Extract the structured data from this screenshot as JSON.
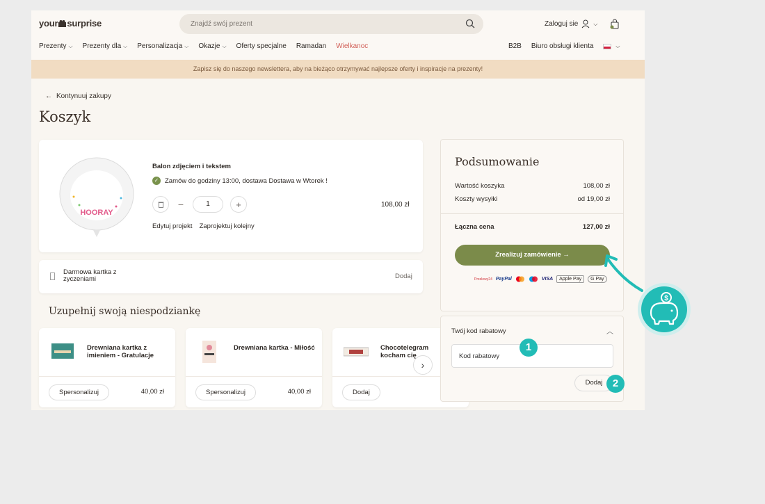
{
  "header": {
    "logo_left": "your",
    "logo_right": "surprise",
    "search_placeholder": "Znajdź swój prezent",
    "login_label": "Zaloguj sie"
  },
  "nav": {
    "items": [
      "Prezenty",
      "Prezenty dla",
      "Personalizacja",
      "Okazje",
      "Oferty specjalne",
      "Ramadan",
      "Wielkanoc"
    ],
    "right": [
      "B2B",
      "Biuro obsługi klienta"
    ]
  },
  "banner": "Zapisz się do naszego newslettera, aby na bieżąco otrzymywać najlepsze oferty i inspiracje na prezenty!",
  "back_link": "Kontynuuj zakupy",
  "page_title": "Koszyk",
  "cart_item": {
    "name": "Balon zdjęciem i tekstem",
    "delivery": "Zamów do godziny 13:00, dostawa Dostawa w Wtorek !",
    "quantity": "1",
    "price": "108,00 zł",
    "edit_link": "Edytuj projekt",
    "design_link": "Zaprojektuj kolejny",
    "balloon_text": "HOORAY"
  },
  "greeting_card": {
    "label": "Darmowa kartka z zyczeniami",
    "action": "Dodaj"
  },
  "upsell": {
    "title": "Uzupełnij swoją niespodziankę",
    "products": [
      {
        "name": "Drewniana kartka z imieniem - Gratulacje",
        "button": "Spersonalizuj",
        "price": "40,00 zł"
      },
      {
        "name": "Drewniana kartka - Miłość",
        "button": "Spersonalizuj",
        "price": "40,00 zł"
      },
      {
        "name": "Chocotelegram kocham cię",
        "button": "Dodaj",
        "price": ""
      }
    ]
  },
  "summary": {
    "title": "Podsumowanie",
    "cart_value_label": "Wartość koszyka",
    "cart_value": "108,00 zł",
    "shipping_label": "Koszty wysyłki",
    "shipping_value": "od 19,00 zł",
    "total_label": "Łączna cena",
    "total_value": "127,00 zł",
    "order_button": "Zrealizuj zamówienie →",
    "payment_methods": [
      "Przelewy24",
      "PayPal",
      "Mastercard",
      "Maestro",
      "VISA",
      "Apple Pay",
      "G Pay"
    ]
  },
  "discount": {
    "title": "Twój kod rabatowy",
    "placeholder": "Kod rabatowy",
    "button": "Dodaj"
  },
  "annotations": {
    "step1": "1",
    "step2": "2"
  },
  "colors": {
    "accent_green": "#7b8b4a",
    "teal": "#22bcb6",
    "banner": "#f1dcc2",
    "easter": "#d16058"
  }
}
